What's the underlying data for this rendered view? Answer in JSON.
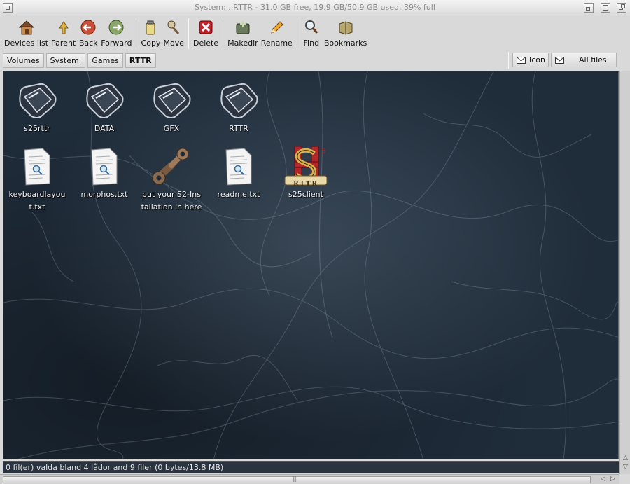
{
  "window": {
    "title": "System:...RTTR - 31.0 GB free, 19.9 GB/50.9 GB used, 39% full"
  },
  "toolbar": {
    "devices_list": "Devices list",
    "parent": "Parent",
    "back": "Back",
    "forward": "Forward",
    "copy": "Copy",
    "move": "Move",
    "delete": "Delete",
    "makedir": "Makedir",
    "rename": "Rename",
    "find": "Find",
    "bookmarks": "Bookmarks"
  },
  "path": {
    "crumbs": [
      "Volumes",
      "System:",
      "Games",
      "RTTR"
    ],
    "view_icon": "Icon",
    "view_files": "All files"
  },
  "icons": [
    {
      "name": "s25rttr",
      "type": "drawer"
    },
    {
      "name": "DATA",
      "type": "drawer"
    },
    {
      "name": "GFX",
      "type": "drawer"
    },
    {
      "name": "RTTR",
      "type": "drawer"
    },
    {
      "name": "keyboardlayout.txt",
      "type": "text"
    },
    {
      "name": "morphos.txt",
      "type": "text"
    },
    {
      "name": "put your S2-Installation in here",
      "type": "tool"
    },
    {
      "name": "readme.txt",
      "type": "text"
    },
    {
      "name": "s25client",
      "type": "app"
    }
  ],
  "app_logo_text": "RTTR",
  "status": {
    "text": "0 fil(er) valda bland 4 lådor and 9 filer (0 bytes/13.8 MB)"
  },
  "colors": {
    "background": "#1f2c3a",
    "label": "#f2f2f2",
    "logo_red": "#b3262a",
    "logo_gold": "#d9b24a"
  }
}
